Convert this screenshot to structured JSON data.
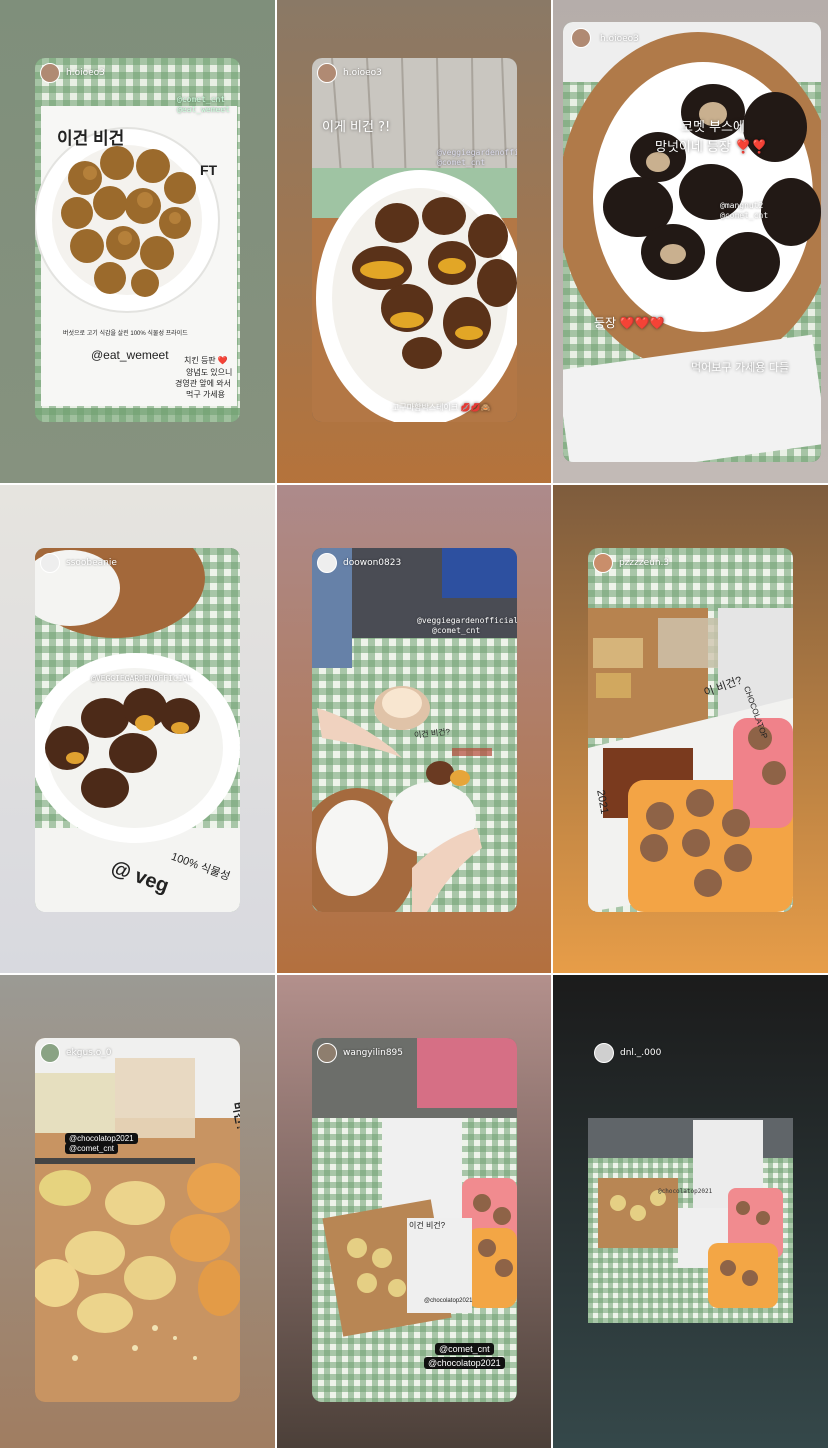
{
  "colors": {
    "tile1_bg": "#7d8d79",
    "tile2_bg": "#a06a3e",
    "tile3_bg": "#b0a9a8",
    "tile4_bg": "#dedee0",
    "tile5_bg": "#a56f5d",
    "tile6_bg": "#c27b38",
    "tile7_bg": "#a09082",
    "tile8_bg": "#8d7f79",
    "tile9_bg": "#1f2b28"
  },
  "stories": [
    {
      "username": "h.oioeo3",
      "tags": [
        "@comet_cnt",
        "@eat_wemeet"
      ],
      "texts": [
        "이건 비건",
        "FT",
        "버섯으로 고기 식감을 살린 100% 식물성 프라이드",
        "@eat_wemeet",
        "치킨 등판 ❤️",
        "양념도 있으니",
        "경영관 앞에 와서",
        "먹구 가세용"
      ]
    },
    {
      "username": "h.oioeo3",
      "tags": [
        "@veggiegardenofficial",
        "@comet_cnt"
      ],
      "texts": [
        "이게 비건 ?!",
        "고구마함박스테이크 💋💋🙈"
      ]
    },
    {
      "username": "h.oioeo3",
      "tags": [
        "@mangnut2",
        "@comet_cnt"
      ],
      "texts": [
        "코멧 부스에",
        "망넛이네 등장 ❣️❣️",
        "등장 ❤️❤️❤️",
        "먹어보구 가세용 다들"
      ]
    },
    {
      "username": "ssoobeanie",
      "tags": [
        "@VEGGIEGARDENOFFICIAL"
      ],
      "texts": [
        "100% 식물성",
        "@ veg"
      ]
    },
    {
      "username": "doowon0823",
      "tags": [
        "@veggiegardenofficial",
        "@comet_cnt"
      ],
      "texts": [
        "이건 비건?"
      ]
    },
    {
      "username": "pzzzzeun.3",
      "tags": [],
      "texts": [
        "CHOCOLATOP",
        "2021",
        "이 비건?"
      ]
    },
    {
      "username": "ekgus.o_0",
      "tags": [
        "@chocolatop2021",
        "@comet_cnt"
      ],
      "texts": [
        "비건?"
      ]
    },
    {
      "username": "wangyilin895",
      "tags": [
        "@comet_cnt",
        "@chocolatop2021"
      ],
      "texts": [
        "이건 비건?",
        "@chocolatop2021"
      ]
    },
    {
      "username": "dnl._.000",
      "tags": [
        "@chocolatop2021"
      ],
      "texts": []
    }
  ]
}
